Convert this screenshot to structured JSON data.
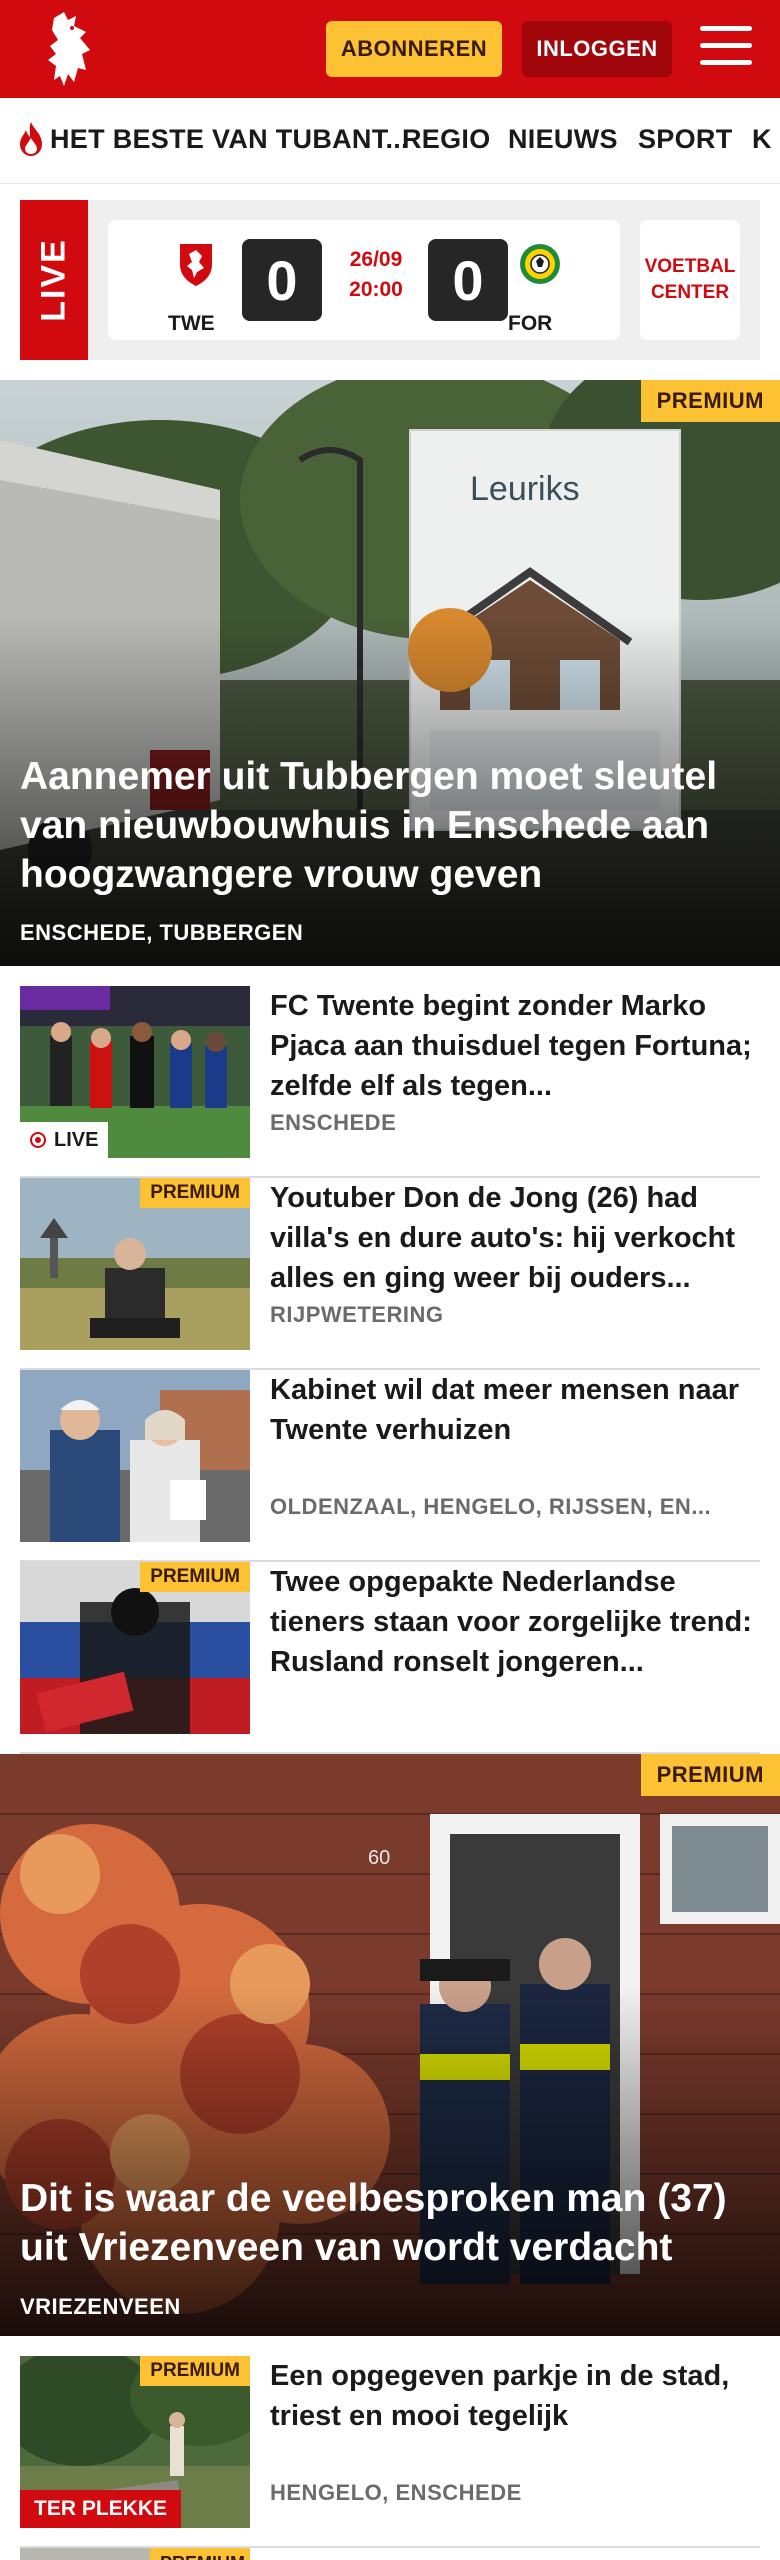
{
  "header": {
    "subscribe_label": "ABONNEREN",
    "login_label": "INLOGGEN",
    "brand_color": "#d10a10",
    "accent_color": "#fdc233"
  },
  "nav": {
    "items": [
      "HET BESTE VAN TUBANT...",
      "REGIO",
      "NIEUWS",
      "SPORT",
      "K"
    ]
  },
  "live": {
    "label": "LIVE",
    "home_code": "TWE",
    "away_code": "FOR",
    "home_score": "0",
    "away_score": "0",
    "date": "26/09",
    "time": "20:00",
    "voetbal_line1": "VOETBAL",
    "voetbal_line2": "CENTER"
  },
  "hero1": {
    "badge": "PREMIUM",
    "title": "Aannemer uit Tubbergen moet sleutel van nieuwbouwhuis in Enschede aan hoogzwangere vrouw geven",
    "tags": "ENSCHEDE, TUBBERGEN",
    "sign_text": "Leuriks"
  },
  "articles": [
    {
      "title": "FC Twente begint zonder Marko Pjaca aan thuisduel tegen Fortuna; zelfde elf als tegen...",
      "tags": "ENSCHEDE",
      "badge": "LIVE"
    },
    {
      "title": "Youtuber Don de Jong (26) had villa's en dure auto's: hij verkocht alles en ging weer bij ouders...",
      "tags": "RIJPWETERING",
      "badge": "PREMIUM"
    },
    {
      "title": "Kabinet wil dat meer mensen naar Twente verhuizen",
      "tags": "OLDENZAAL, HENGELO, RIJSSEN, EN...",
      "badge": ""
    },
    {
      "title": "Twee opgepakte Nederlandse tieners staan voor zorgelijke trend: Rusland ronselt jongeren...",
      "tags": "",
      "badge": "PREMIUM"
    }
  ],
  "hero2": {
    "badge": "PREMIUM",
    "title": "Dit is waar de veelbesproken man (37) uit Vriezenveen van wordt verdacht",
    "tags": "VRIEZENVEEN",
    "house_number": "60"
  },
  "articles2": [
    {
      "title": "Een opgegeven parkje in de stad, triest en mooi tegelijk",
      "tags": "HENGELO, ENSCHEDE",
      "badge": "PREMIUM",
      "badge2": "TER PLEKKE"
    }
  ],
  "partial": {
    "badge": "PREMIUM"
  }
}
